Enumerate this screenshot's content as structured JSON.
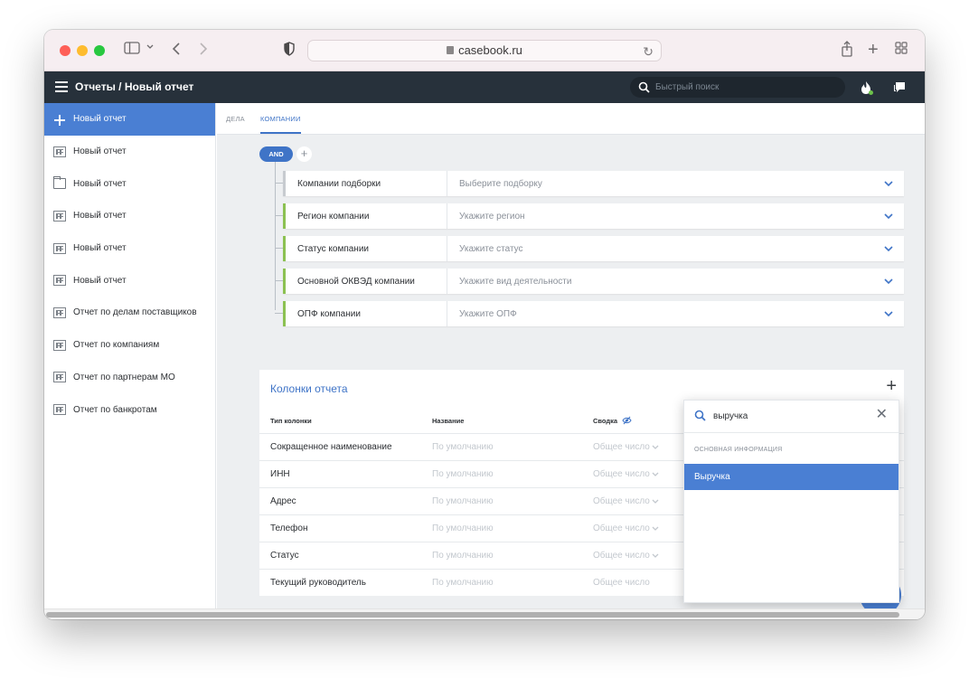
{
  "browser": {
    "url": "casebook.ru"
  },
  "app": {
    "title": "Отчеты / Новый отчет",
    "search_placeholder": "Быстрый поиск"
  },
  "sidebar": {
    "items": [
      {
        "label": "Новый отчет",
        "icon": "plus-icon"
      },
      {
        "label": "Новый отчет",
        "icon": "building-icon"
      },
      {
        "label": "Новый отчет",
        "icon": "folder-icon"
      },
      {
        "label": "Новый отчет",
        "icon": "building-icon"
      },
      {
        "label": "Новый отчет",
        "icon": "building-icon"
      },
      {
        "label": "Новый отчет",
        "icon": "building-icon"
      },
      {
        "label": "Отчет по делам поставщиков",
        "icon": "building-icon"
      },
      {
        "label": "Отчет по компаниям",
        "icon": "building-icon"
      },
      {
        "label": "Отчет по партнерам МО",
        "icon": "building-icon"
      },
      {
        "label": "Отчет по банкротам",
        "icon": "building-icon"
      }
    ]
  },
  "tabs": [
    {
      "label": "Дела"
    },
    {
      "label": "Компании"
    }
  ],
  "filters": {
    "operator": "AND",
    "conditions": [
      {
        "label": "Компании подборки",
        "placeholder": "Выберите подборку"
      },
      {
        "label": "Регион компании",
        "placeholder": "Укажите регион"
      },
      {
        "label": "Статус компании",
        "placeholder": "Укажите статус"
      },
      {
        "label": "Основной ОКВЭД компании",
        "placeholder": "Укажите вид деятельности"
      },
      {
        "label": "ОПФ компании",
        "placeholder": "Укажите ОПФ"
      }
    ]
  },
  "columns": {
    "heading": "Колонки отчета",
    "headers": {
      "type": "Тип колонки",
      "name": "Название",
      "summary": "Сводка"
    },
    "rows": [
      {
        "type": "Сокращенное наименование",
        "name": "По умолчанию",
        "summary": "Общее число"
      },
      {
        "type": "ИНН",
        "name": "По умолчанию",
        "summary": "Общее число"
      },
      {
        "type": "Адрес",
        "name": "По умолчанию",
        "summary": "Общее число"
      },
      {
        "type": "Телефон",
        "name": "По умолчанию",
        "summary": "Общее число"
      },
      {
        "type": "Статус",
        "name": "По умолчанию",
        "summary": "Общее число"
      },
      {
        "type": "Текущий руководитель",
        "name": "По умолчанию",
        "summary": "Общее число"
      }
    ]
  },
  "dropdown": {
    "query": "выручка",
    "group": "Основная информация",
    "option": "Выручка"
  },
  "colors": {
    "accent": "#4a7fd3",
    "header_bg": "#27313b",
    "filter_active": "#8cc152"
  }
}
